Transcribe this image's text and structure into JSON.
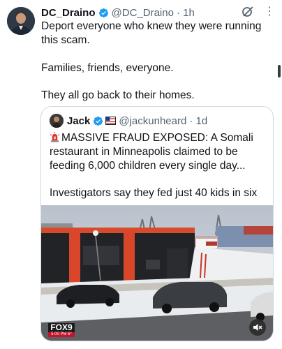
{
  "tweet": {
    "author_name": "DC_Draino",
    "author_handle": "@DC_Draino",
    "time": "· 1h",
    "more_label": "⋮",
    "lines": [
      "Deport everyone who knew they were running this scam.",
      "Families, friends, everyone.",
      "They all go back to their homes."
    ]
  },
  "quote": {
    "author_name": "Jack",
    "author_handle": "@jackunheard",
    "time": "· 1d",
    "lines": [
      "MASSIVE FRAUD EXPOSED: A Somali restaurant in Minneapolis claimed to be feeding 6,000 children every single day...",
      "Investigators say they fed just 40 kids in six ..."
    ],
    "media": {
      "channel_logo": "FOX9",
      "broadcast_time": "5:00 PM",
      "temperature": "6°"
    }
  },
  "colors": {
    "verified_blue": "#1d9bf0",
    "border": "#cfd9de",
    "muted_text": "#536471",
    "siren_red": "#e0303a"
  },
  "icons": [
    "verified-badge-icon",
    "grok-icon",
    "more-icon",
    "siren-icon",
    "flag-icon",
    "mute-icon"
  ]
}
